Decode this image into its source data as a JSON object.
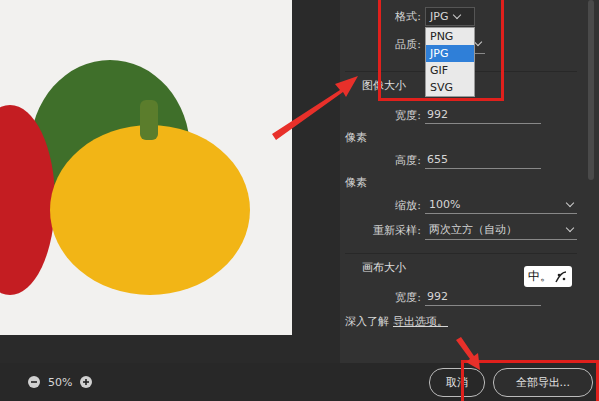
{
  "preview": {
    "zoom": "50%"
  },
  "format": {
    "label": "格式:",
    "value": "JPG",
    "menu_open": true,
    "options": [
      {
        "label": "PNG",
        "selected": false
      },
      {
        "label": "JPG",
        "selected": true
      },
      {
        "label": "GIF",
        "selected": false
      },
      {
        "label": "SVG",
        "selected": false
      }
    ]
  },
  "quality": {
    "label": "品质:"
  },
  "image_size": {
    "title": "图像大小",
    "fields": [
      {
        "label": "宽度:",
        "value": "992",
        "unit": "像素",
        "kind": "input"
      },
      {
        "label": "高度:",
        "value": "655",
        "unit": "像素",
        "kind": "input"
      },
      {
        "label": "缩放:",
        "value": "100%",
        "unit": "",
        "kind": "dropdown"
      },
      {
        "label": "重新采样:",
        "value": "两次立方（自动）",
        "unit": "",
        "kind": "dropdown"
      }
    ]
  },
  "canvas_size": {
    "title": "画布大小",
    "fields": [
      {
        "label": "宽度:",
        "value": "992",
        "unit": "",
        "kind": "input"
      }
    ]
  },
  "learn_more": {
    "text": "深入了解",
    "link": "导出选项。"
  },
  "buttons": [
    {
      "label": "取消",
      "primary": false
    },
    {
      "label": "全部导出...",
      "primary": true
    }
  ],
  "ime_badge": "中。"
}
